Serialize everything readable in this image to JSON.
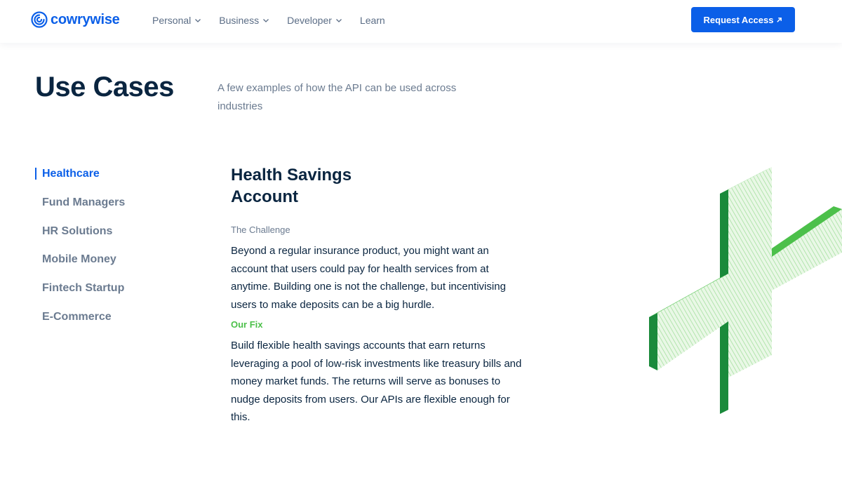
{
  "nav": {
    "logo_text": "cowrywise",
    "items": [
      {
        "label": "Personal",
        "has_dropdown": true
      },
      {
        "label": "Business",
        "has_dropdown": true
      },
      {
        "label": "Developer",
        "has_dropdown": true
      },
      {
        "label": "Learn",
        "has_dropdown": false
      }
    ],
    "cta_label": "Request Access"
  },
  "header": {
    "title": "Use Cases",
    "subtitle": "A few examples of how the API can be used across industries"
  },
  "sidebar": {
    "items": [
      {
        "label": "Healthcare",
        "active": true
      },
      {
        "label": "Fund Managers",
        "active": false
      },
      {
        "label": "HR Solutions",
        "active": false
      },
      {
        "label": "Mobile Money",
        "active": false
      },
      {
        "label": "Fintech Startup",
        "active": false
      },
      {
        "label": "E-Commerce",
        "active": false
      }
    ]
  },
  "content": {
    "title": "Health Savings Account",
    "challenge_label": "The Challenge",
    "challenge_text": "Beyond a regular insurance product, you might want an account that users could pay for health services from at anytime. Building one is not the challenge, but incentivising users to make deposits can be a big hurdle.",
    "fix_label": "Our Fix",
    "fix_text": "Build flexible health savings accounts that earn returns leveraging a pool of low-risk investments like treasury bills and money market funds. The returns will serve as bonuses to nudge deposits from users. Our APIs are flexible enough for this."
  },
  "colors": {
    "brand_blue": "#0b5fe8",
    "navy": "#0a2540",
    "muted": "#6b7b90",
    "fix_green": "#4cc04a",
    "cross_green": "#3fbf4a"
  },
  "icons": {
    "logo": "cowrywise-swirl-icon",
    "dropdown": "chevron-down-icon",
    "cta": "arrow-up-right-icon",
    "illustration": "medical-cross-illustration"
  }
}
